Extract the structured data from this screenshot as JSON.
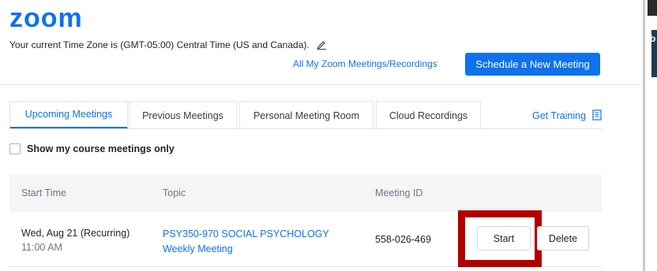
{
  "brand": {
    "logo_text": "zoom",
    "accent_color": "#0e72ed"
  },
  "header": {
    "timezone_text": "Your current Time Zone is (GMT-05:00) Central Time (US and Canada).",
    "all_meetings_link": "All My Zoom Meetings/Recordings",
    "schedule_button": "Schedule a New Meeting"
  },
  "tabs": [
    {
      "label": "Upcoming Meetings",
      "active": true
    },
    {
      "label": "Previous Meetings",
      "active": false
    },
    {
      "label": "Personal Meeting Room",
      "active": false
    },
    {
      "label": "Cloud Recordings",
      "active": false
    }
  ],
  "get_training": {
    "label": "Get Training",
    "icon": "book-icon"
  },
  "filter": {
    "label": "Show my course meetings only",
    "checked": false
  },
  "table": {
    "columns": [
      "Start Time",
      "Topic",
      "Meeting ID"
    ],
    "rows": [
      {
        "start_date": "Wed, Aug 21 (Recurring)",
        "start_time": "11:00 AM",
        "topic": "PSY350-970 SOCIAL PSYCHOLOGY Weekly Meeting",
        "meeting_id": "558-026-469",
        "start_label": "Start",
        "delete_label": "Delete"
      }
    ]
  },
  "annotation": {
    "highlight_color": "#b30000"
  }
}
